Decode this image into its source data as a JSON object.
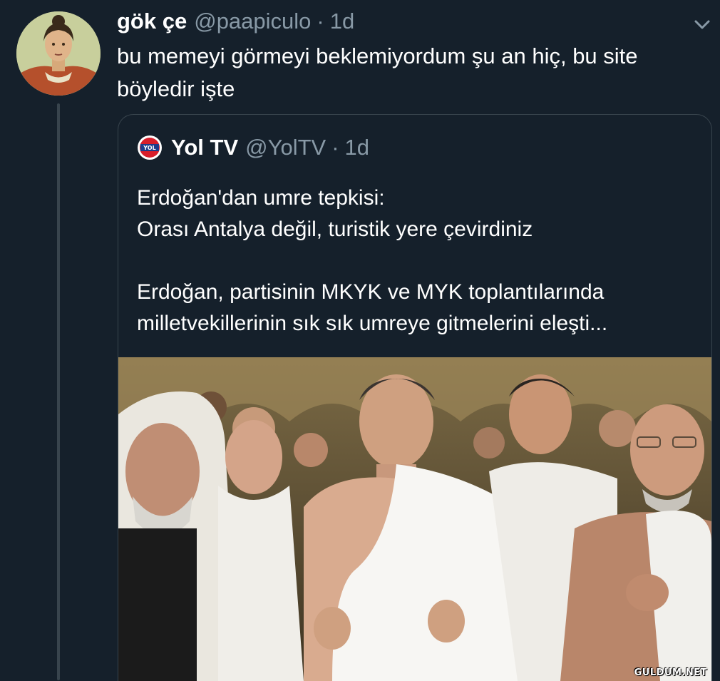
{
  "tweet": {
    "display_name": "gök çe",
    "handle": "@paapiculo",
    "separator": "·",
    "time": "1d",
    "text": "bu memeyi görmeyi beklemiyordum şu an hiç, bu site böyledir işte",
    "more_icon": "chevron-down-icon"
  },
  "quoted_tweet": {
    "display_name": "Yol TV",
    "handle": "@YolTV",
    "separator": "·",
    "time": "1d",
    "logo_text": "YOL",
    "line1": "Erdoğan'dan umre tepkisi:",
    "line2": "Orası Antalya değil, turistik yere çevirdiniz",
    "line3": "Erdoğan, partisinin MKYK ve MYK toplantılarında milletvekillerinin sık sık umreye gitmelerini eleşti..."
  },
  "watermark": "GULDUM.NET",
  "colors": {
    "background": "#15202b",
    "text": "#ffffff",
    "secondary": "#8899a6",
    "border": "#38444d"
  }
}
